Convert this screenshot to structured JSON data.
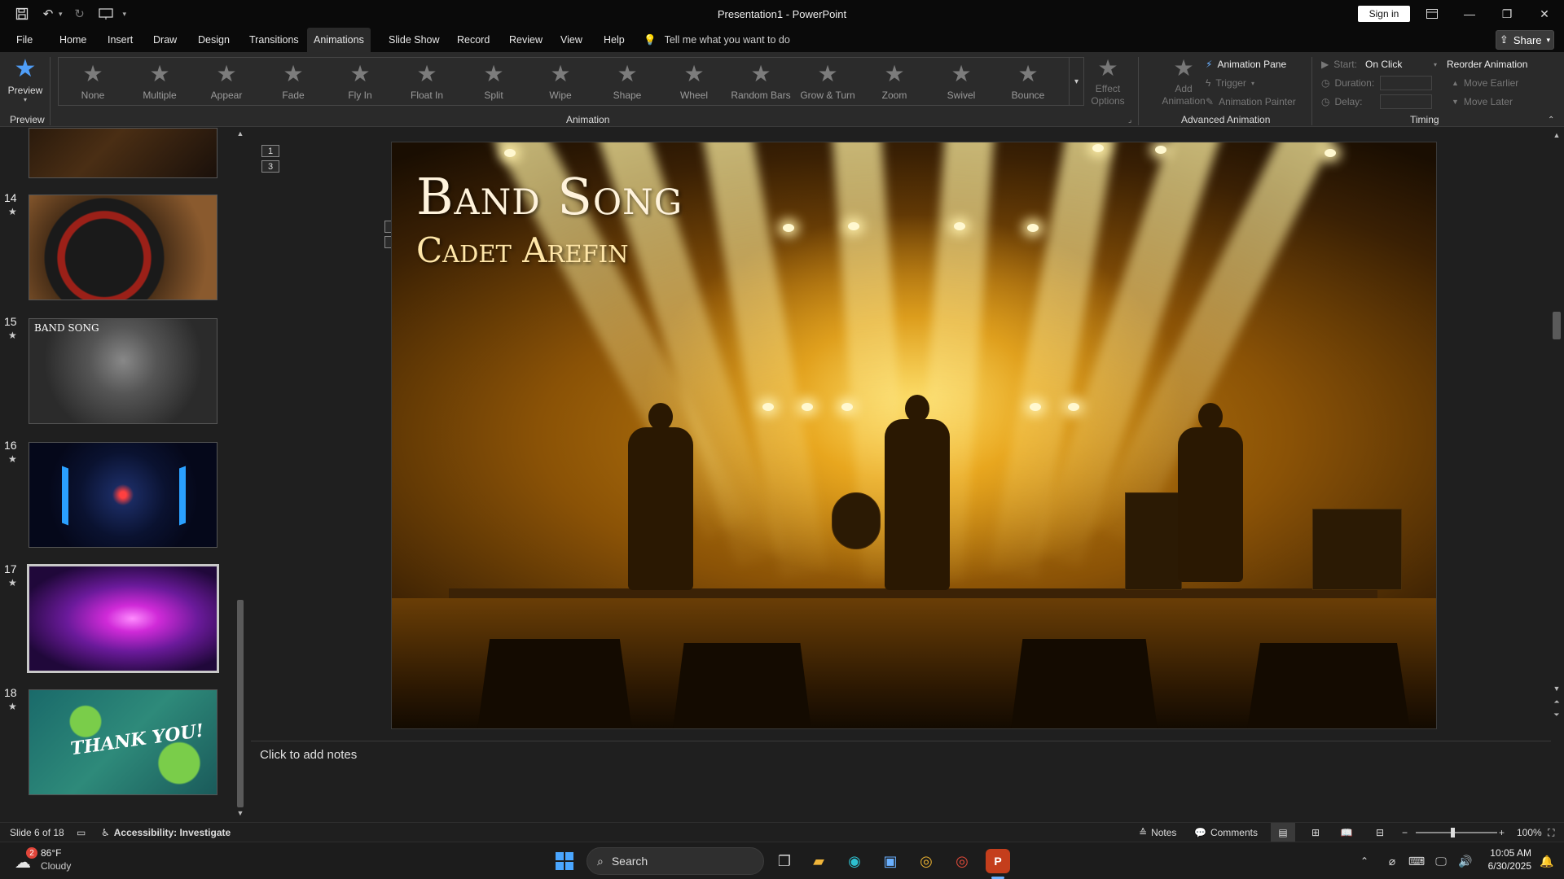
{
  "window": {
    "title": "Presentation1  -  PowerPoint",
    "signin_label": "Sign in",
    "share_label": "Share"
  },
  "tabs": [
    "File",
    "Home",
    "Insert",
    "Draw",
    "Design",
    "Transitions",
    "Animations",
    "Slide Show",
    "Record",
    "Review",
    "View",
    "Help"
  ],
  "active_tab": "Animations",
  "tell_me": "Tell me what you want to do",
  "ribbon": {
    "preview": {
      "label": "Preview",
      "group": "Preview"
    },
    "animation_group": "Animation",
    "animations": [
      "None",
      "Multiple",
      "Appear",
      "Fade",
      "Fly In",
      "Float In",
      "Split",
      "Wipe",
      "Shape",
      "Wheel",
      "Random Bars",
      "Grow & Turn",
      "Zoom",
      "Swivel",
      "Bounce"
    ],
    "effect_options": [
      "Effect",
      "Options"
    ],
    "add_animation": [
      "Add",
      "Animation"
    ],
    "advanced_group": "Advanced Animation",
    "animation_pane": "Animation Pane",
    "trigger": "Trigger",
    "animation_painter": "Animation Painter",
    "timing_group": "Timing",
    "start_label": "Start:",
    "start_value": "On Click",
    "duration_label": "Duration:",
    "delay_label": "Delay:",
    "reorder": "Reorder Animation",
    "move_earlier": "Move Earlier",
    "move_later": "Move Later"
  },
  "thumbnails": [
    {
      "num": "14",
      "star": "★"
    },
    {
      "num": "15",
      "star": "★",
      "overlay": "BAND SONG"
    },
    {
      "num": "16",
      "star": "★"
    },
    {
      "num": "17",
      "star": "★"
    },
    {
      "num": "18",
      "star": "★",
      "overlay": "THANK YOU!"
    }
  ],
  "slide": {
    "title": "Band Song",
    "subtitle": "Cadet Arefin",
    "anim_tags": [
      "1",
      "3",
      "2",
      "3"
    ]
  },
  "notes_placeholder": "Click to add notes",
  "status": {
    "slide_of": "Slide 6 of 18",
    "accessibility": "Accessibility: Investigate",
    "notes": "Notes",
    "comments": "Comments",
    "zoom_minus": "−",
    "zoom_plus": "+",
    "zoom": "100%"
  },
  "taskbar": {
    "weather_temp": "86°F",
    "weather_desc": "Cloudy",
    "weather_badge": "2",
    "search_label": "Search",
    "time": "10:05 AM",
    "date": "6/30/2025"
  }
}
